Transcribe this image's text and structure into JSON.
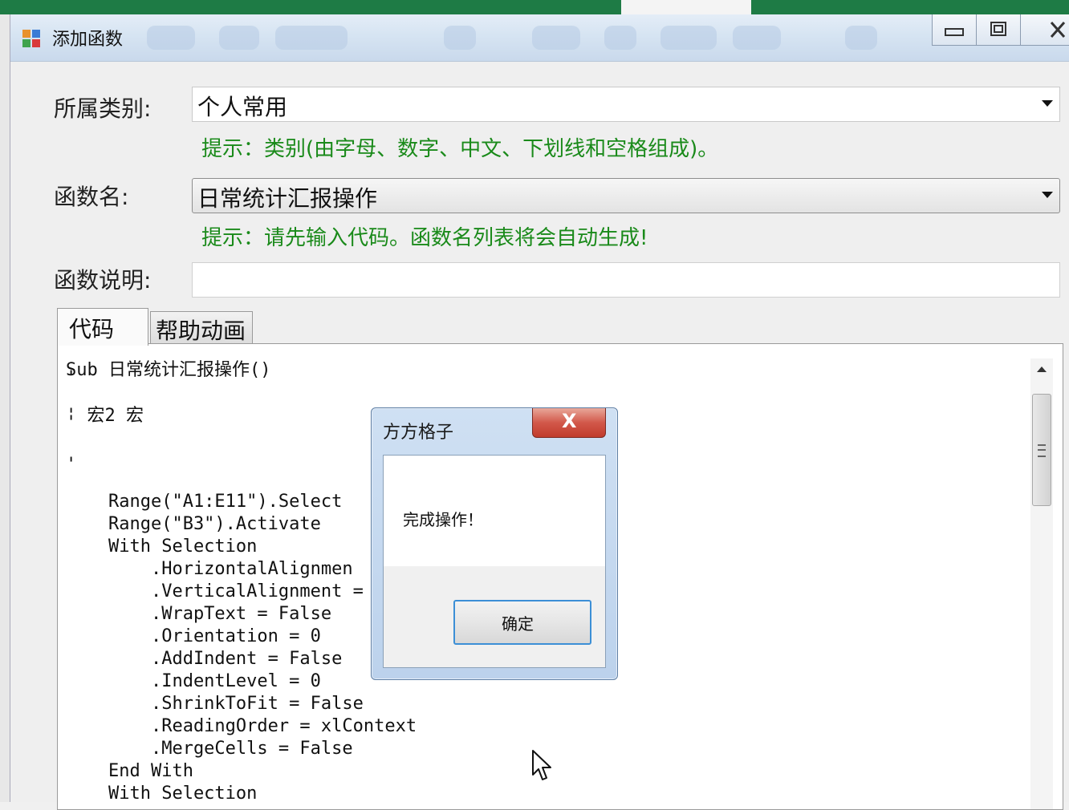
{
  "window": {
    "title": "添加函数",
    "minimize_label": "▭",
    "restore_label": "⧉",
    "close_label": "✕"
  },
  "form": {
    "category_label": "所属类别:",
    "category_value": "个人常用",
    "category_hint": "提示：类别(由字母、数字、中文、下划线和空格组成)。",
    "function_name_label": "函数名:",
    "function_name_value": "日常统计汇报操作",
    "function_name_hint": "提示：请先输入代码。函数名列表将会自动生成!",
    "description_label": "函数说明:",
    "description_value": ""
  },
  "tabs": [
    {
      "label": "代码"
    },
    {
      "label": "帮助动画"
    }
  ],
  "code_lines": [
    "Sub 日常统计汇报操作()",
    "'",
    "' 宏2 宏",
    "'",
    "",
    "'",
    "    Range(\"A1:E11\").Select",
    "    Range(\"B3\").Activate",
    "    With Selection",
    "        .HorizontalAlignmen",
    "        .VerticalAlignment =",
    "        .WrapText = False",
    "        .Orientation = 0",
    "        .AddIndent = False",
    "        .IndentLevel = 0",
    "        .ShrinkToFit = False",
    "        .ReadingOrder = xlContext",
    "        .MergeCells = False",
    "    End With",
    "    With Selection"
  ],
  "dialog": {
    "title": "方方格子",
    "close_label": "X",
    "message": "完成操作！",
    "ok_label": "确定"
  },
  "colors": {
    "hint_green": "#1a8a1a",
    "excel_green": "#1e7b45",
    "dialog_close_red": "#c13b2c"
  }
}
